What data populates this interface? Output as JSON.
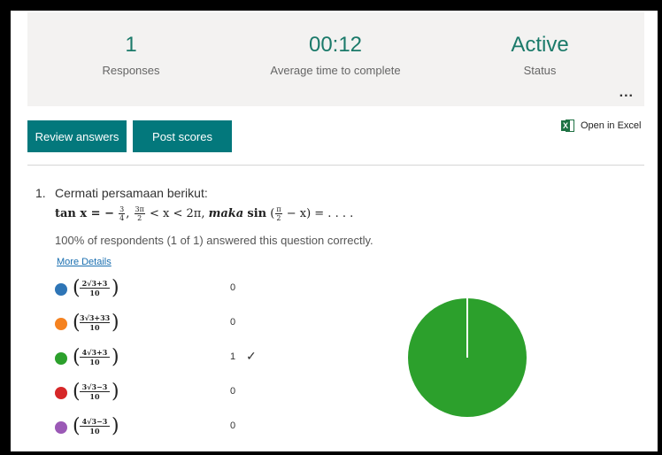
{
  "summary": {
    "responses": {
      "value": "1",
      "label": "Responses"
    },
    "avg_time": {
      "value": "00:12",
      "label": "Average time to complete"
    },
    "status": {
      "value": "Active",
      "label": "Status"
    },
    "more_label": "..."
  },
  "toolbar": {
    "review_label": "Review answers",
    "post_label": "Post scores",
    "excel_label": "Open in Excel",
    "excel_icon": "excel-icon"
  },
  "question": {
    "number": "1.",
    "title": "Cermati persamaan berikut:",
    "formula": {
      "lhs": "tan x = −",
      "frac1": {
        "num": "3",
        "den": "4"
      },
      "sep": ",",
      "frac2": {
        "num": "3π",
        "den": "2"
      },
      "range": "< x < 2π,",
      "maka": "maka",
      "sin": "sin",
      "frac3": {
        "num": "π",
        "den": "2"
      },
      "rest": "− x) = . . . ."
    },
    "result_text": "100% of respondents (1 of 1) answered this question correctly.",
    "more_details_label": "More Details",
    "options": [
      {
        "num": "2√3+3",
        "den": "10",
        "count": "0",
        "color": "#2e75b6",
        "correct": false
      },
      {
        "num": "3√3+33",
        "den": "10",
        "count": "0",
        "color": "#f58220",
        "correct": false
      },
      {
        "num": "4√3+3",
        "den": "10",
        "count": "1",
        "color": "#2ca02c",
        "correct": true,
        "check": "✓"
      },
      {
        "num": "3√3−3",
        "den": "10",
        "count": "0",
        "color": "#d62728",
        "correct": false
      },
      {
        "num": "4√3−3",
        "den": "10",
        "count": "0",
        "color": "#9b59b6",
        "correct": false
      }
    ]
  },
  "chart_data": {
    "type": "pie",
    "categories": [
      "(2√3+3)/10",
      "(3√3+33)/10",
      "(4√3+3)/10",
      "(3√3−3)/10",
      "(4√3−3)/10"
    ],
    "values": [
      0,
      0,
      1,
      0,
      0
    ],
    "colors": [
      "#2e75b6",
      "#f58220",
      "#2ca02c",
      "#d62728",
      "#9b59b6"
    ]
  }
}
